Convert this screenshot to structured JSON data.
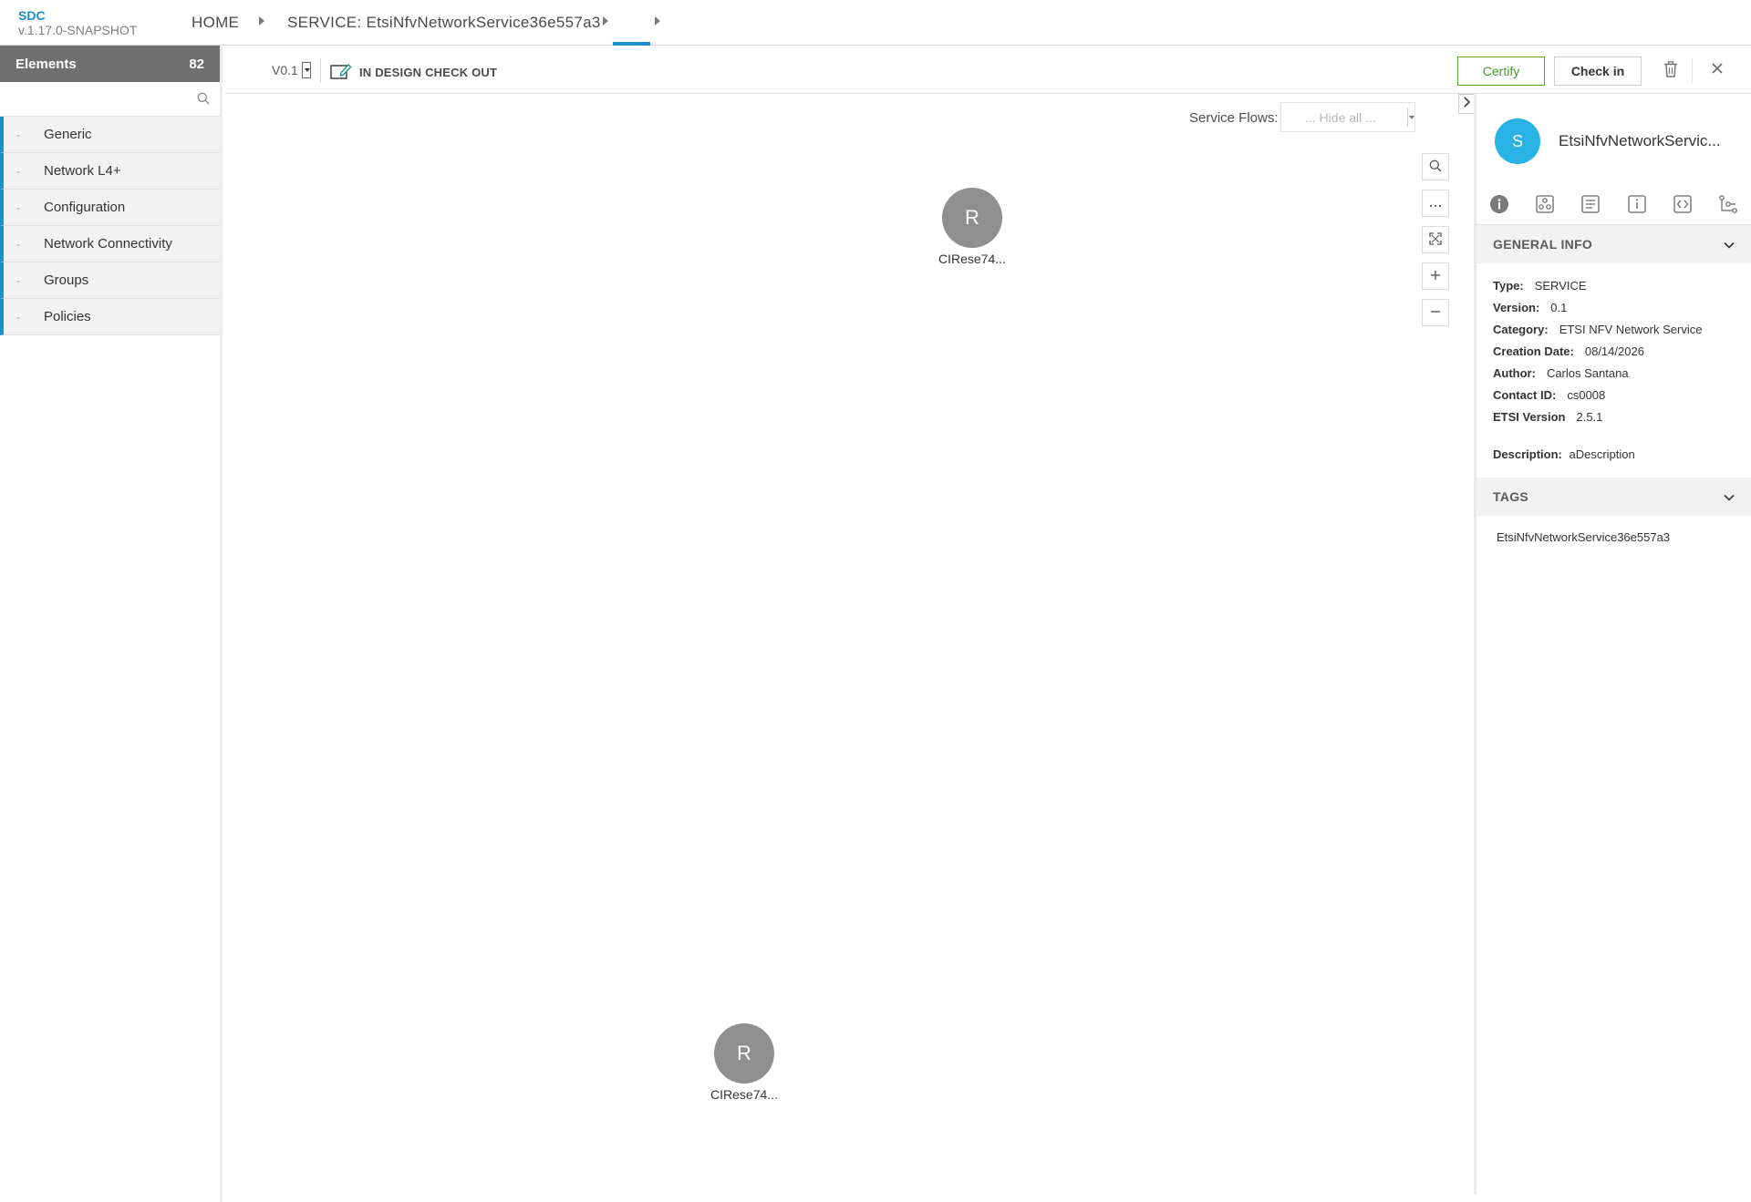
{
  "app": {
    "name": "SDC",
    "version": "v.1.17.0-SNAPSHOT"
  },
  "breadcrumb": {
    "home": "HOME",
    "service": "SERVICE: EtsiNfvNetworkService36e557a3"
  },
  "left_panel": {
    "title": "Elements",
    "count": "82",
    "search_placeholder": "",
    "categories": [
      {
        "dash": "-",
        "label": "Generic"
      },
      {
        "dash": "-",
        "label": "Network L4+"
      },
      {
        "dash": "-",
        "label": "Configuration"
      },
      {
        "dash": "-",
        "label": "Network Connectivity"
      },
      {
        "dash": "-",
        "label": "Groups"
      },
      {
        "dash": "-",
        "label": "Policies"
      }
    ]
  },
  "toolbar": {
    "version": "V0.1",
    "status": "IN DESIGN CHECK OUT",
    "certify_label": "Certify",
    "checkin_label": "Check in",
    "accent_green": "#5aad2d"
  },
  "canvas": {
    "service_flows_label": "Service Flows:",
    "service_flows_value": "... Hide all ...",
    "nodes": [
      {
        "initial": "R",
        "label": "CIRese74..."
      },
      {
        "initial": "R",
        "label": "CIRese74..."
      }
    ]
  },
  "right_panel": {
    "avatar_initial": "S",
    "title": "EtsiNfvNetworkServic...",
    "tabs": [
      "info-icon",
      "composition-icon",
      "deployment-artifacts-icon",
      "properties-icon",
      "api-icon",
      "service-paths-icon"
    ],
    "general_info": {
      "heading": "GENERAL INFO",
      "rows": [
        {
          "key": "Type:",
          "value": "SERVICE"
        },
        {
          "key": "Version:",
          "value": "0.1"
        },
        {
          "key": "Category:",
          "value": "ETSI NFV Network Service"
        },
        {
          "key": "Creation Date:",
          "value": "08/14/2026"
        },
        {
          "key": "Author:",
          "value": "Carlos Santana"
        },
        {
          "key": "Contact ID:",
          "value": "cs0008"
        },
        {
          "key": "ETSI Version",
          "value": "2.5.1"
        }
      ],
      "description_key": "Description:",
      "description_value": "aDescription"
    },
    "tags": {
      "heading": "TAGS",
      "items": [
        "EtsiNfvNetworkService36e557a3"
      ]
    }
  },
  "colors": {
    "brand_blue": "#1b8fc9",
    "avatar_blue": "#28b3e4",
    "node_gray": "#8f8f8f"
  }
}
